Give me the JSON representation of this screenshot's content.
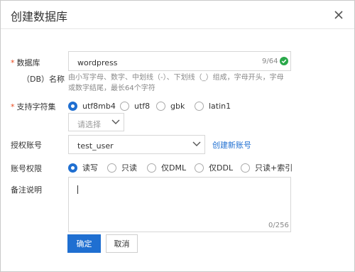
{
  "dialog": {
    "title": "创建数据库",
    "close_icon": "close-icon"
  },
  "db_name": {
    "label": "数据库",
    "sub_label": "（DB）名称",
    "required_mark": "*",
    "value": "wordpress",
    "counter": "9/64",
    "status_icon": "check-circle-icon",
    "hint": "由小写字母、数字、中划线（-）、下划线（_）组成，字母开头，字母或数字结尾，最长64个字符"
  },
  "charset": {
    "label": "支持字符集",
    "required_mark": "*",
    "options": [
      "utf8mb4",
      "utf8",
      "gbk",
      "latin1"
    ],
    "selected": "utf8mb4",
    "select_placeholder": "请选择"
  },
  "account": {
    "label": "授权账号",
    "value": "test_user",
    "create_link": "创建新账号"
  },
  "permission": {
    "label": "账号权限",
    "options": [
      "读写",
      "只读",
      "仅DML",
      "仅DDL",
      "只读+索引"
    ],
    "selected": "读写"
  },
  "remark": {
    "label": "备注说明",
    "value": "",
    "counter": "0/256"
  },
  "buttons": {
    "confirm": "确定",
    "cancel": "取消"
  },
  "colors": {
    "primary": "#1f6fd1",
    "success": "#2aa84a",
    "required": "#e84a1e"
  }
}
